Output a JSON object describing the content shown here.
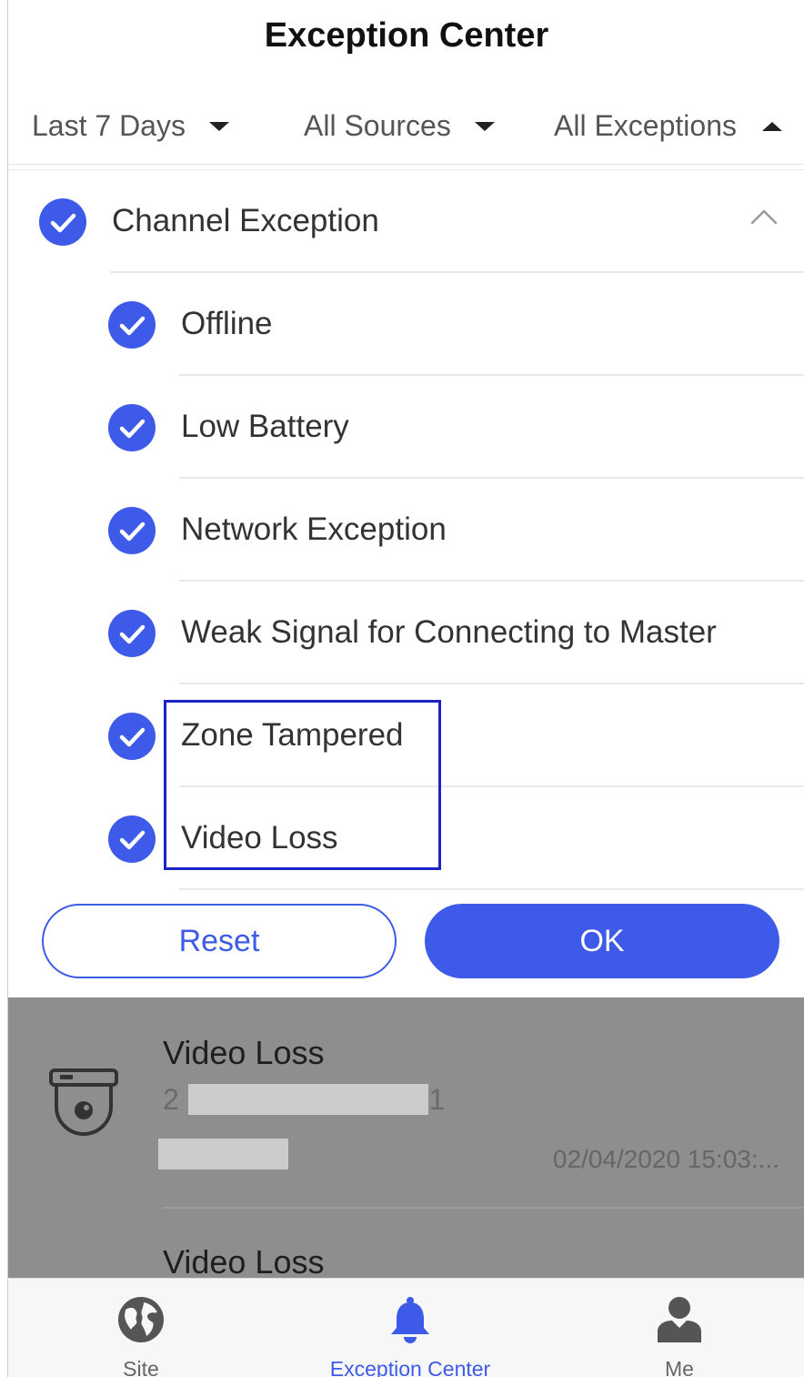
{
  "header": {
    "title": "Exception Center"
  },
  "filters": {
    "time": "Last 7 Days",
    "source": "All Sources",
    "exception": "All Exceptions"
  },
  "exception_filter": {
    "group_label": "Channel Exception",
    "group_checked": true,
    "items": [
      {
        "label": "Offline",
        "checked": true
      },
      {
        "label": "Low Battery",
        "checked": true
      },
      {
        "label": "Network Exception",
        "checked": true
      },
      {
        "label": "Weak Signal for Connecting to Master",
        "checked": true
      },
      {
        "label": "Zone Tampered",
        "checked": true
      },
      {
        "label": "Video Loss",
        "checked": true
      }
    ],
    "reset_label": "Reset",
    "ok_label": "OK"
  },
  "exception_list": {
    "items": [
      {
        "title": "Video Loss",
        "subtitle_prefix": "2",
        "subtitle_suffix": "a 1",
        "time": "02/04/2020 15:03:..."
      },
      {
        "title": "Video Loss"
      }
    ]
  },
  "tabbar": {
    "tabs": [
      {
        "label": "Site",
        "icon": "globe-icon"
      },
      {
        "label": "Exception Center",
        "icon": "bell-icon",
        "active": true
      },
      {
        "label": "Me",
        "icon": "person-icon"
      }
    ]
  },
  "colors": {
    "accent": "#3d5be8",
    "highlight_box": "#1a22c8",
    "overlay": "#8e8e8e"
  }
}
